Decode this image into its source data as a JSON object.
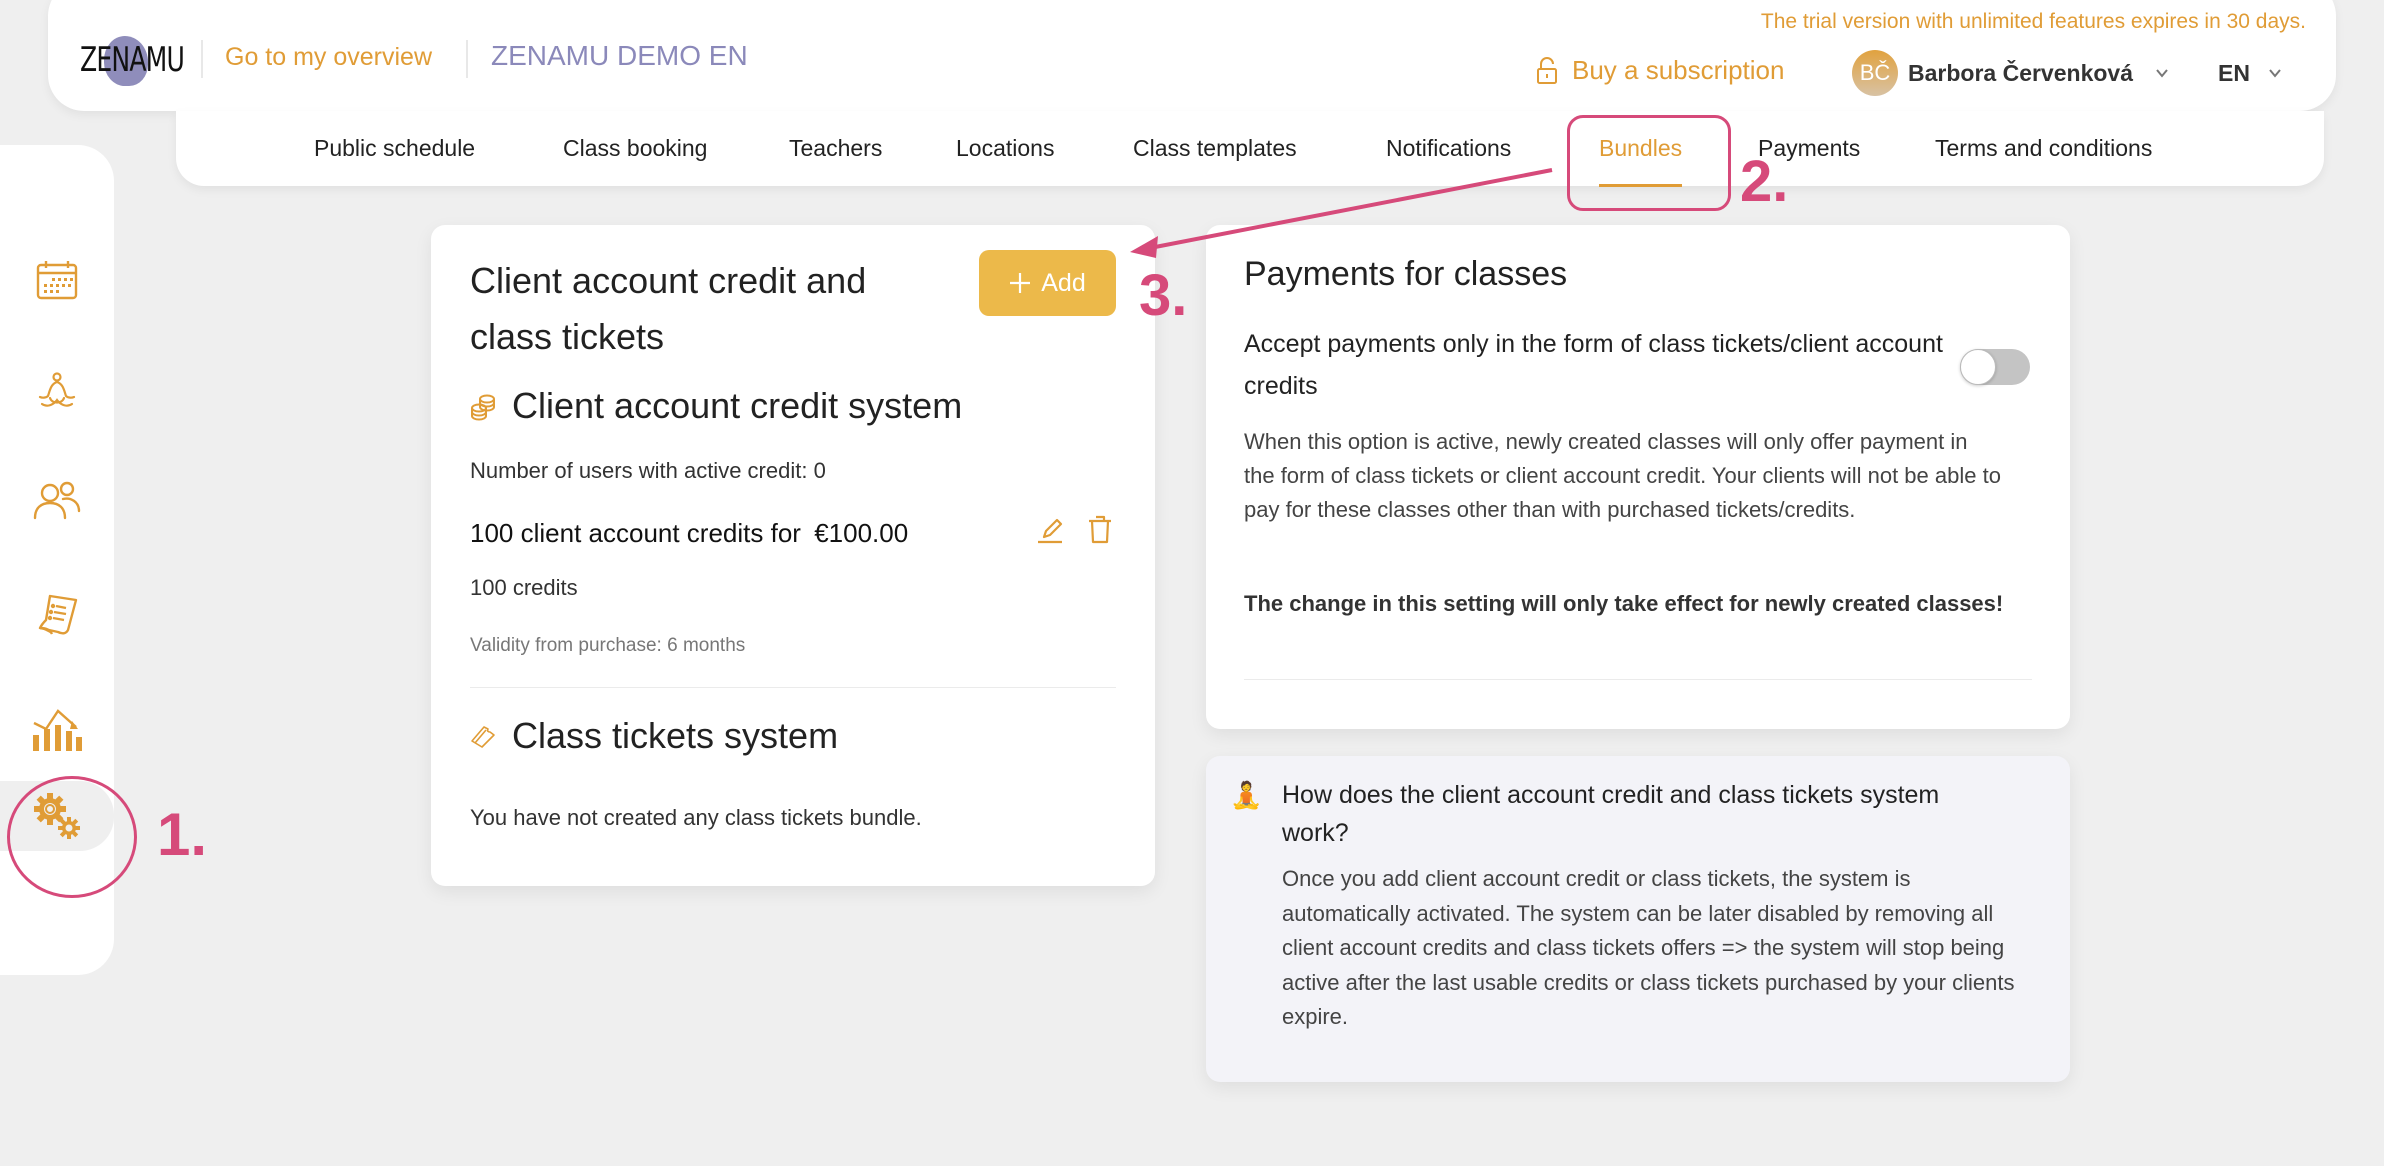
{
  "header": {
    "logo_text": "ZENAMU",
    "overview_link": "Go to my overview",
    "studio_name": "ZENAMU DEMO EN",
    "trial_notice": "The trial version with unlimited features expires in 30 days.",
    "buy_subscription": "Buy a subscription",
    "user": {
      "initials": "BČ",
      "name": "Barbora Červenková"
    },
    "language": "EN"
  },
  "nav": {
    "items": [
      {
        "label": "Public schedule",
        "active": false
      },
      {
        "label": "Class booking",
        "active": false
      },
      {
        "label": "Teachers",
        "active": false
      },
      {
        "label": "Locations",
        "active": false
      },
      {
        "label": "Class templates",
        "active": false
      },
      {
        "label": "Notifications",
        "active": false
      },
      {
        "label": "Bundles",
        "active": true
      },
      {
        "label": "Payments",
        "active": false
      },
      {
        "label": "Terms and conditions",
        "active": false
      }
    ]
  },
  "sidebar": {
    "items": [
      {
        "icon": "calendar-icon",
        "active": false
      },
      {
        "icon": "yoga-icon",
        "active": false
      },
      {
        "icon": "users-icon",
        "active": false
      },
      {
        "icon": "receipt-icon",
        "active": false
      },
      {
        "icon": "statistics-icon",
        "active": false
      },
      {
        "icon": "settings-icon",
        "active": true
      }
    ]
  },
  "bundles_card": {
    "title": "Client account credit and class tickets",
    "add_button": "Add",
    "credit_section": {
      "heading": "Client account credit system",
      "active_users": "Number of users with active credit: 0",
      "offers": [
        {
          "title": "100 client account credits for",
          "price": "€100.00",
          "credits": "100 credits",
          "validity": "Validity from purchase: 6 months"
        }
      ]
    },
    "tickets_section": {
      "heading": "Class tickets system",
      "empty_message": "You have not created any class tickets bundle."
    }
  },
  "payments_card": {
    "title": "Payments for classes",
    "toggle_label": "Accept payments only in the form of class tickets/client account credits",
    "toggle_on": false,
    "description": "When this option is active, newly created classes will only offer payment in the form of class tickets or client account credit. Your clients will not be able to pay for these classes other than with purchased tickets/credits.",
    "warning": "The change in this setting will only take effect for newly created classes!"
  },
  "info_box": {
    "icon": "🧘",
    "title": "How does the client account credit and class tickets system work?",
    "text": "Once you add client account credit or class tickets, the system is automatically activated. The system can be later disabled by removing all client account credits and class tickets offers => the system will stop being active after the last usable credits or class tickets purchased by your clients expire."
  },
  "annotations": {
    "step1": "1.",
    "step2": "2.",
    "step3": "3."
  },
  "colors": {
    "accent": "#e09c36",
    "button": "#ecb94a",
    "annotation": "#d64a7a",
    "studio_name": "#8b89ba"
  }
}
